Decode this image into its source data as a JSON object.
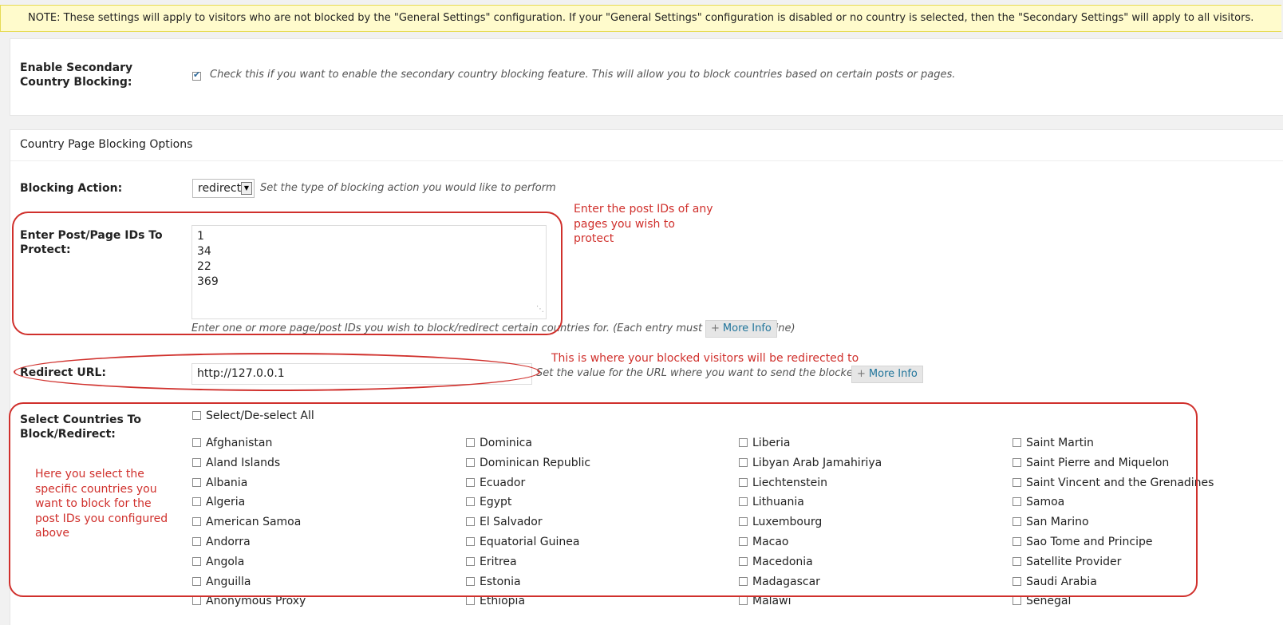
{
  "notice": {
    "text": "NOTE: These settings will apply to visitors who are not blocked by the \"General Settings\" configuration. If your \"General Settings\" configuration is disabled or no country is selected, then the \"Secondary Settings\" will apply to all visitors."
  },
  "enable": {
    "label": "Enable Secondary Country Blocking:",
    "checked": true,
    "description": "Check this if you want to enable the secondary country blocking feature. This will allow you to block countries based on certain posts or pages."
  },
  "section_title": "Country Page Blocking Options",
  "blocking_action": {
    "label": "Blocking Action:",
    "value": "redirect",
    "description": "Set the type of blocking action you would like to perform"
  },
  "post_ids": {
    "label": "Enter Post/Page IDs To Protect:",
    "lines": [
      "1",
      "34",
      "22",
      "369"
    ],
    "description": "Enter one or more page/post IDs you wish to block/redirect certain countries for. (Each entry must be on a new line)",
    "more_info": "More Info"
  },
  "redirect": {
    "label": "Redirect URL:",
    "value": "http://127.0.0.1",
    "description": "Set the value for the URL where you want to send the blocked visitor to",
    "more_info": "More Info"
  },
  "countries": {
    "label": "Select Countries To Block/Redirect:",
    "select_all": "Select/De-select All",
    "columns": [
      [
        "Afghanistan",
        "Aland Islands",
        "Albania",
        "Algeria",
        "American Samoa",
        "Andorra",
        "Angola",
        "Anguilla",
        "Anonymous Proxy"
      ],
      [
        "Dominica",
        "Dominican Republic",
        "Ecuador",
        "Egypt",
        "El Salvador",
        "Equatorial Guinea",
        "Eritrea",
        "Estonia",
        "Ethiopia"
      ],
      [
        "Liberia",
        "Libyan Arab Jamahiriya",
        "Liechtenstein",
        "Lithuania",
        "Luxembourg",
        "Macao",
        "Macedonia",
        "Madagascar",
        "Malawi"
      ],
      [
        "Saint Martin",
        "Saint Pierre and Miquelon",
        "Saint Vincent and the Grenadines",
        "Samoa",
        "San Marino",
        "Sao Tome and Principe",
        "Satellite Provider",
        "Saudi Arabia",
        "Senegal"
      ]
    ]
  },
  "annotations": {
    "post_ids": "Enter the post IDs of any pages you wish to protect",
    "redirect": "This is where your blocked visitors will be redirected to",
    "countries": "Here you select the specific countries you want to block for the post IDs you configured above"
  },
  "colors": {
    "annotation": "#d0302c",
    "notice_bg": "#fffbcc",
    "link": "#21759b"
  }
}
